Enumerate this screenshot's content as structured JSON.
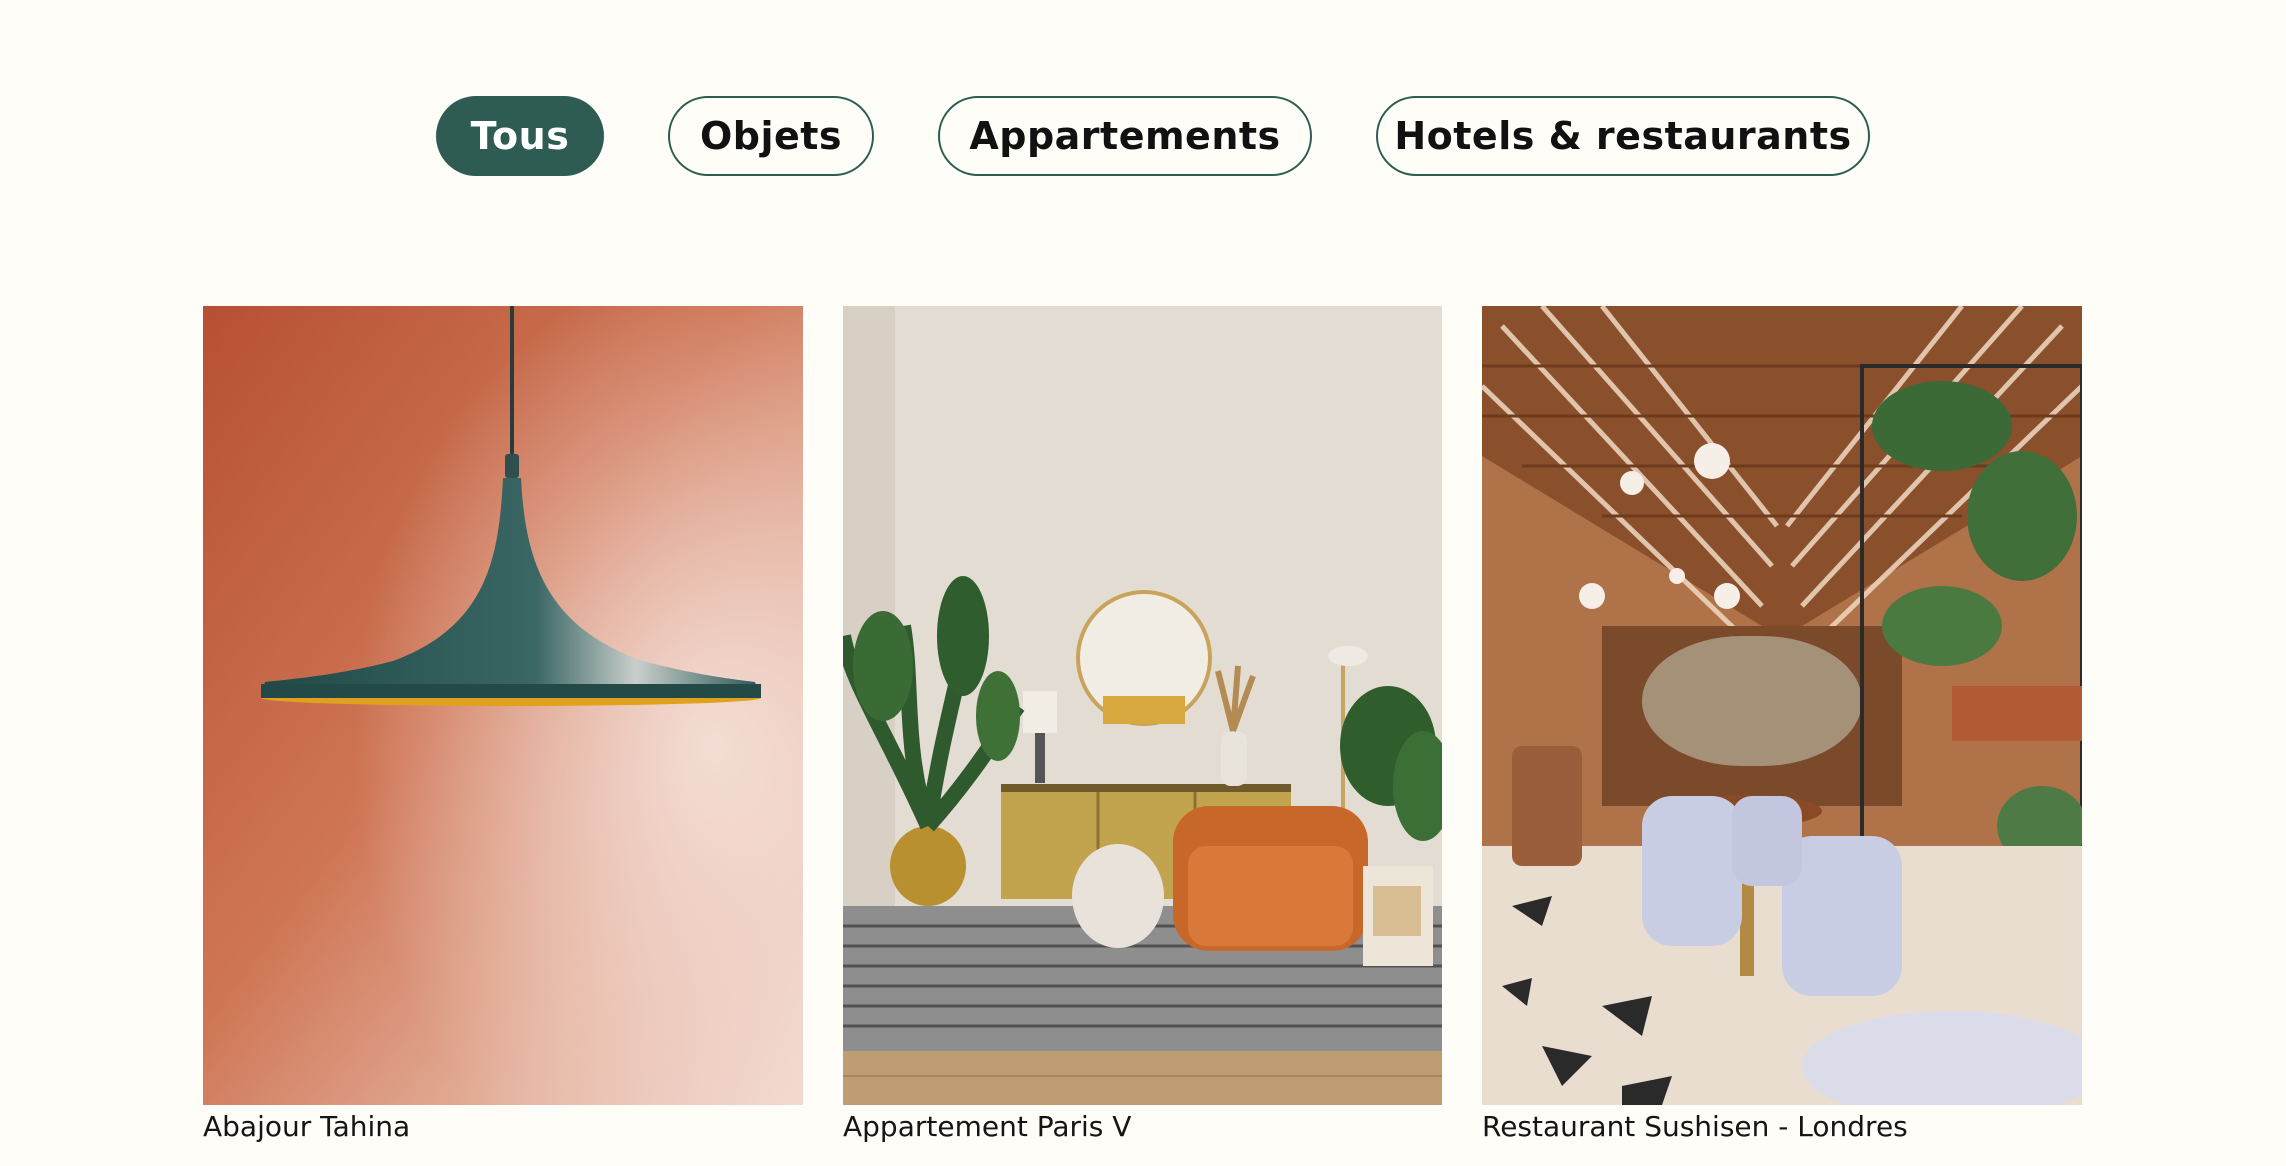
{
  "filters": {
    "items": [
      {
        "label": "Tous",
        "active": true
      },
      {
        "label": "Objets",
        "active": false
      },
      {
        "label": "Appartements",
        "active": false
      },
      {
        "label": "Hotels & restaurants",
        "active": false
      }
    ]
  },
  "projects": [
    {
      "caption": "Abajour Tahina",
      "image": "green-pendant-lamp-on-terracotta-wall"
    },
    {
      "caption": "Appartement Paris V",
      "image": "living-room-orange-armchair-plants"
    },
    {
      "caption": "Restaurant Sushisen - Londres",
      "image": "restaurant-interior-wooden-roof-plants"
    }
  ],
  "colors": {
    "background": "#fefdf7",
    "accent": "#2e5c53",
    "text": "#111111"
  }
}
